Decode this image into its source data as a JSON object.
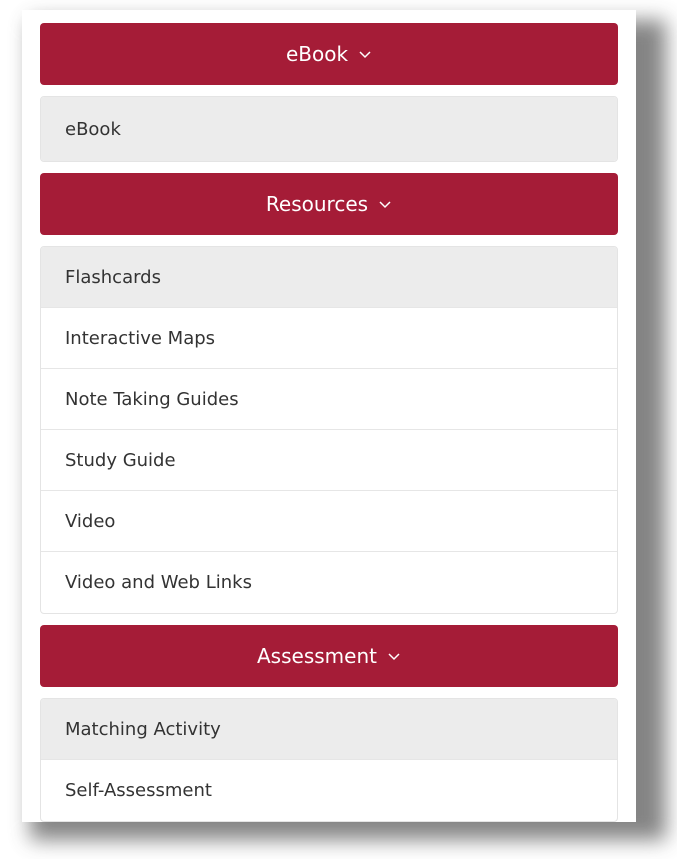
{
  "colors": {
    "header_bg": "#a51c37",
    "header_text": "#ffffff",
    "active_item_bg": "#ececec",
    "item_text": "#333333"
  },
  "sections": [
    {
      "title": "eBook",
      "icon": "chevron-down-icon",
      "items": [
        {
          "label": "eBook",
          "active": true
        }
      ]
    },
    {
      "title": "Resources",
      "icon": "chevron-down-icon",
      "items": [
        {
          "label": "Flashcards",
          "active": true
        },
        {
          "label": "Interactive Maps",
          "active": false
        },
        {
          "label": "Note Taking Guides",
          "active": false
        },
        {
          "label": "Study Guide",
          "active": false
        },
        {
          "label": "Video",
          "active": false
        },
        {
          "label": "Video and Web Links",
          "active": false
        }
      ]
    },
    {
      "title": "Assessment",
      "icon": "chevron-down-icon",
      "items": [
        {
          "label": "Matching Activity",
          "active": true
        },
        {
          "label": "Self-Assessment",
          "active": false
        }
      ]
    }
  ]
}
